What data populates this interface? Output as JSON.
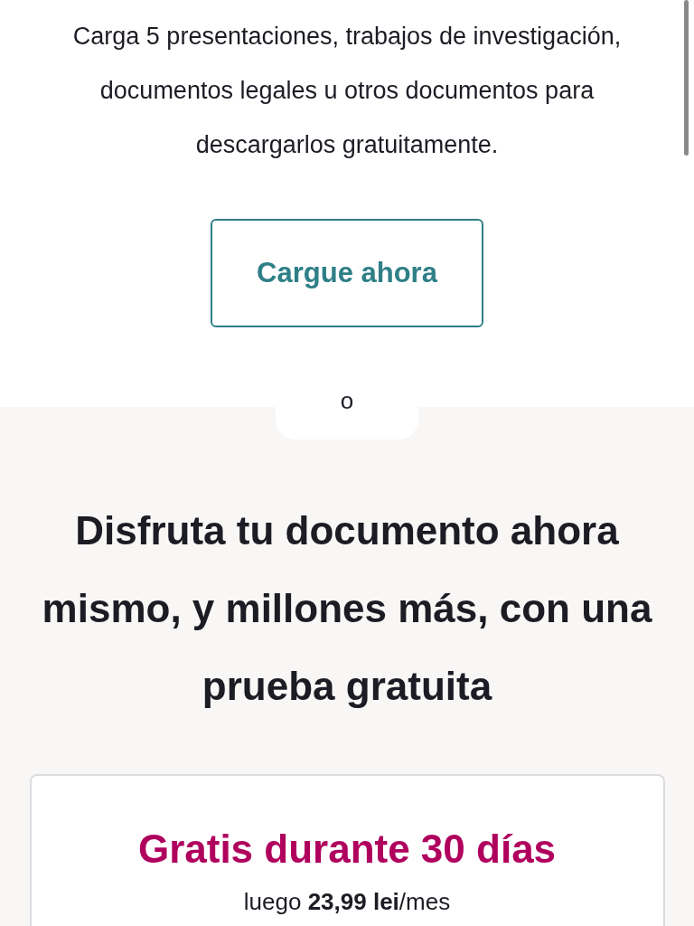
{
  "upload": {
    "description": "Carga 5 presentaciones, trabajos de investigación, documentos legales u otros documentos para descargarlos gratuitamente.",
    "button": "Cargue ahora"
  },
  "divider_label": "o",
  "trial": {
    "heading": "Disfruta tu documento ahora mismo, y millones más, con una prueba gratuita",
    "offer": "Gratis durante 30 días",
    "price": "luego **23,99 lei**/mes"
  }
}
